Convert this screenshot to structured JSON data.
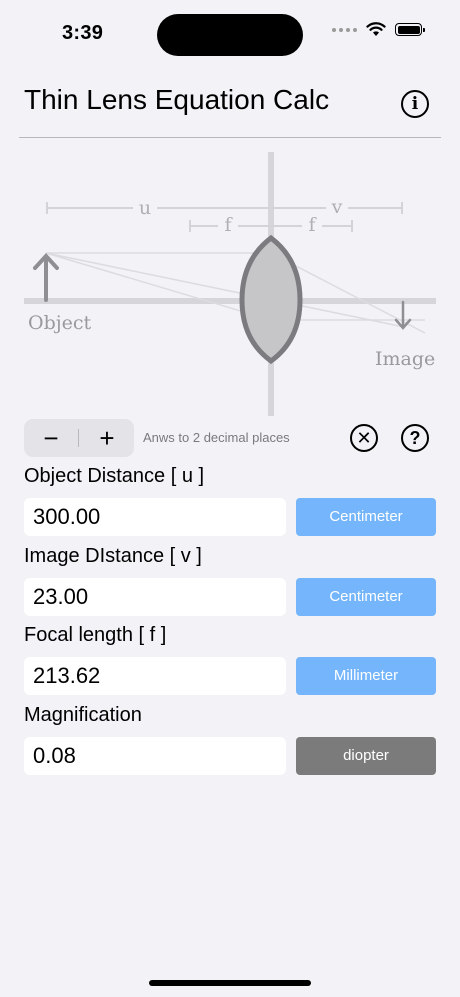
{
  "status": {
    "time": "3:39"
  },
  "nav": {
    "title": "Thin Lens Equation Calc"
  },
  "diagram": {
    "u": "u",
    "v": "v",
    "f_left": "f",
    "f_right": "f",
    "object": "Object",
    "image": "Image"
  },
  "controls": {
    "minus": "−",
    "plus": "+",
    "precision_text": "Anws to 2 decimal places",
    "clear_symbol": "✕",
    "help_symbol": "?"
  },
  "fields": [
    {
      "label": "Object Distance [ u ]",
      "value": "300.00",
      "unit": "Centimeter"
    },
    {
      "label": "Image DIstance [ v ]",
      "value": "23.00",
      "unit": "Centimeter"
    },
    {
      "label": "Focal length [ f ]",
      "value": "213.62",
      "unit": "Millimeter"
    },
    {
      "label": "Magnification",
      "value": "0.08",
      "unit": "diopter"
    }
  ],
  "colors": {
    "unit_blue": "#74b5fc",
    "unit_gray": "#7b7b7b",
    "background": "#f2f2f7"
  }
}
